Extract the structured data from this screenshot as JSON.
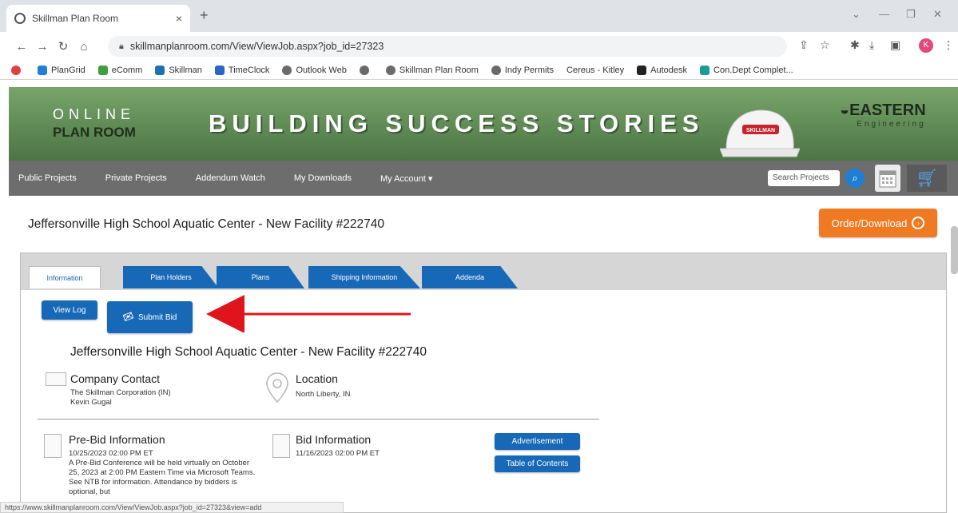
{
  "browser": {
    "tab_title": "Skillman Plan Room",
    "tab_close": "×",
    "new_tab": "+",
    "url": "skillmanplanroom.com/View/ViewJob.aspx?job_id=27323",
    "profile_initial": "K",
    "bookmarks": [
      {
        "label": "PlanGrid",
        "color": "#1e7fd3"
      },
      {
        "label": "eComm",
        "color": "#3f9c3f"
      },
      {
        "label": "Skillman",
        "color": "#1f6fb5"
      },
      {
        "label": "TimeClock",
        "color": "#2a64c4"
      },
      {
        "label": "Outlook Web",
        "color": "#6a6a6a"
      },
      {
        "label": "Skillman Plan Room",
        "color": "#6a6a6a"
      },
      {
        "label": "Indy Permits",
        "color": "#6a6a6a"
      },
      {
        "label": "Cereus - Kitley",
        "color": "#ffffff"
      },
      {
        "label": "Autodesk",
        "color": "#222222"
      },
      {
        "label": "Con.Dept Complet...",
        "color": "#1c9a9a"
      }
    ],
    "status_url": "https://www.skillmanplanroom.com/View/ViewJob.aspx?job_id=27323&view=add"
  },
  "banner": {
    "online": "ONLINE",
    "plan_room": "PLAN ROOM",
    "slogan": "BUILDING SUCCESS STORIES",
    "hat_text": "SKILLMAN",
    "eastern": "EASTERN",
    "engineering": "Engineering"
  },
  "nav": {
    "items": [
      "Public Projects",
      "Private Projects",
      "Addendum Watch",
      "My Downloads",
      "My Account ▾"
    ],
    "search_placeholder": "Search Projects"
  },
  "page": {
    "title": "Jeffersonville High School Aquatic Center - New Facility #222740",
    "order_button": "Order/Download",
    "tabs": [
      "Information",
      "Plan Holders",
      "Plans",
      "Shipping Information",
      "Addenda"
    ],
    "view_log": "View Log",
    "submit_bid": "Submit Bid",
    "subtitle": "Jeffersonville High School Aquatic Center - New Facility #222740",
    "company_contact": {
      "heading": "Company Contact",
      "line1": "The Skillman Corporation (IN)",
      "line2": "Kevin Gugal"
    },
    "location": {
      "heading": "Location",
      "line1": "North Liberty, IN"
    },
    "prebid": {
      "heading": "Pre-Bid Information",
      "date": "10/25/2023 02:00 PM ET",
      "body": "A Pre-Bid Conference will be held virtually on October 25, 2023 at 2:00 PM Eastern Time via Microsoft Teams. See NTB for information. Attendance by bidders is optional, but"
    },
    "bid": {
      "heading": "Bid Information",
      "date": "11/16/2023 02:00 PM ET"
    },
    "advertisement": "Advertisement",
    "toc": "Table of Contents"
  },
  "colors": {
    "banner_green": "#5f8a55",
    "nav_gray": "#6d6d6d",
    "action_blue": "#1769b8",
    "order_orange": "#f07a22",
    "arrow_red": "#e0141b"
  }
}
